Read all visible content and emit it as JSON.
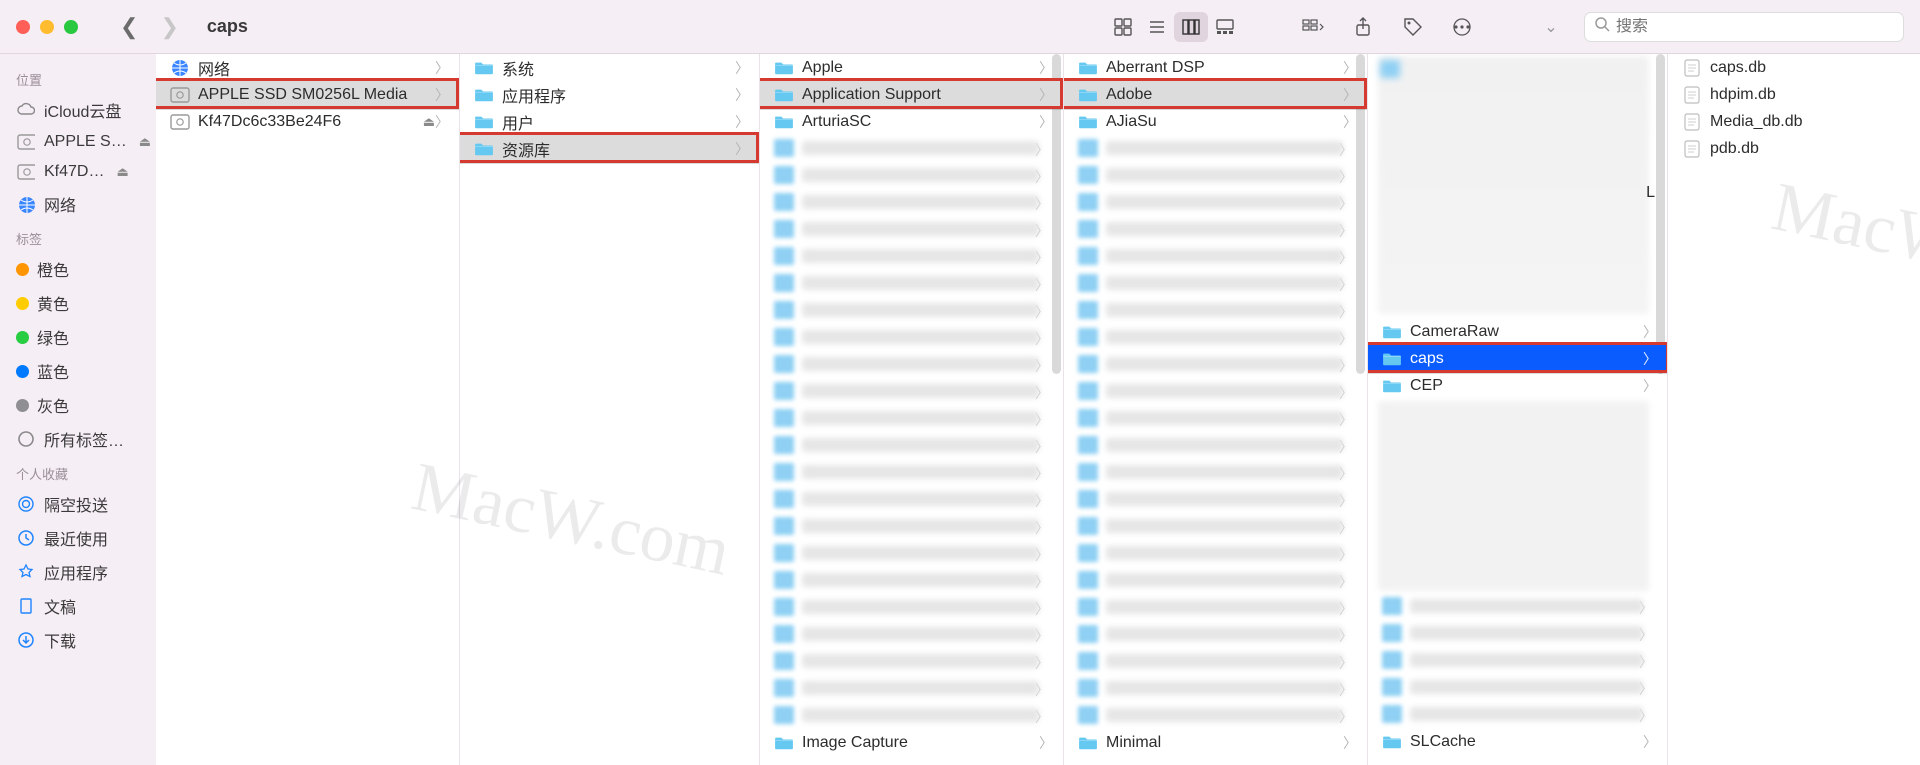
{
  "window": {
    "title": "caps",
    "search_placeholder": "搜索"
  },
  "sidebar": {
    "section_locations": "位置",
    "section_tags": "标签",
    "section_favorites": "个人收藏",
    "locations": [
      {
        "icon": "cloud",
        "label": "iCloud云盘"
      },
      {
        "icon": "disk",
        "label": "APPLE S…",
        "eject": true
      },
      {
        "icon": "disk",
        "label": "Kf47D…",
        "eject": true
      },
      {
        "icon": "globe",
        "label": "网络"
      }
    ],
    "tags": [
      {
        "color": "#ff9500",
        "label": "橙色"
      },
      {
        "color": "#ffcc00",
        "label": "黄色"
      },
      {
        "color": "#28cd41",
        "label": "绿色"
      },
      {
        "color": "#007aff",
        "label": "蓝色"
      },
      {
        "color": "#8e8e93",
        "label": "灰色"
      },
      {
        "icon": "alltags",
        "label": "所有标签…"
      }
    ],
    "favorites": [
      {
        "icon": "airdrop",
        "label": "隔空投送"
      },
      {
        "icon": "clock",
        "label": "最近使用"
      },
      {
        "icon": "appstore",
        "label": "应用程序"
      },
      {
        "icon": "doc",
        "label": "文稿"
      },
      {
        "icon": "download",
        "label": "下载"
      }
    ]
  },
  "columns": {
    "c1": [
      {
        "kind": "globe",
        "label": "网络",
        "chev": true
      },
      {
        "kind": "disk",
        "label": "APPLE SSD SM0256L Media",
        "chev": true,
        "selected": true,
        "highlight": true
      },
      {
        "kind": "disk",
        "label": "Kf47Dc6c33Be24F6",
        "chev": true,
        "eject": true
      }
    ],
    "c2": [
      {
        "kind": "folder",
        "label": "系统",
        "chev": true
      },
      {
        "kind": "folder",
        "label": "应用程序",
        "chev": true
      },
      {
        "kind": "folder",
        "label": "用户",
        "chev": true
      },
      {
        "kind": "folder",
        "label": "资源库",
        "chev": true,
        "selected": true,
        "highlight": true
      }
    ],
    "c3_top": [
      {
        "kind": "folder",
        "label": "Apple",
        "chev": true
      },
      {
        "kind": "folder",
        "label": "Application Support",
        "chev": true,
        "selected": true,
        "highlight": true
      },
      {
        "kind": "folder",
        "label": "ArturiaSC",
        "chev": true
      }
    ],
    "c3_bottom": [
      {
        "kind": "folder",
        "label": "Image Capture",
        "chev": true
      }
    ],
    "c4_top": [
      {
        "kind": "folder",
        "label": "Aberrant DSP",
        "chev": true
      },
      {
        "kind": "folder",
        "label": "Adobe",
        "chev": true,
        "selected": true,
        "highlight": true
      },
      {
        "kind": "folder",
        "label": "AJiaSu",
        "chev": true
      }
    ],
    "c4_bottom": [
      {
        "kind": "folder",
        "label": "Minimal",
        "chev": true
      }
    ],
    "c5_upper": [
      {
        "kind": "folder",
        "label": "CameraRaw",
        "chev": true
      },
      {
        "kind": "folder",
        "label": "caps",
        "chev": true,
        "active": true,
        "highlight": true
      },
      {
        "kind": "folder",
        "label": "CEP",
        "chev": true
      }
    ],
    "c5_bottom": [
      {
        "kind": "folder",
        "label": "SLCache",
        "chev": true
      }
    ],
    "c5_right_label": "L",
    "c6": [
      {
        "kind": "db",
        "label": "caps.db"
      },
      {
        "kind": "db",
        "label": "hdpim.db"
      },
      {
        "kind": "db",
        "label": "Media_db.db"
      },
      {
        "kind": "db",
        "label": "pdb.db"
      }
    ]
  },
  "watermark": "MacW.com"
}
